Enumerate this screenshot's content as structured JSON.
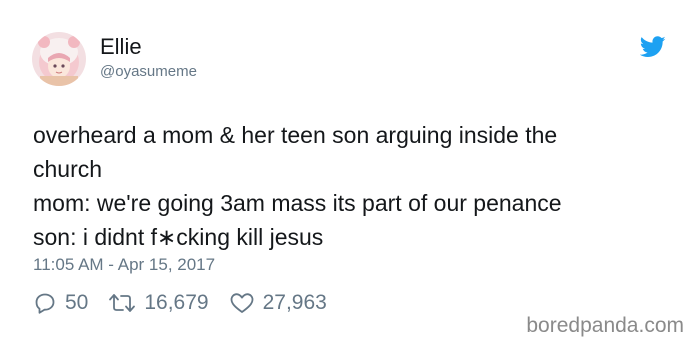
{
  "user": {
    "display_name": "Ellie",
    "handle": "@oyasumeme",
    "avatar_icon": "anime-avatar-icon"
  },
  "brand_icon": "twitter-bird-icon",
  "brand_color": "#1da1f2",
  "tweet": {
    "lines": [
      "overheard a mom & her teen son arguing inside the",
      "church",
      "mom: we're going 3am mass its part of our penance",
      "son: i didnt f∗cking kill jesus"
    ],
    "timestamp": "11:05 AM - Apr 15, 2017"
  },
  "actions": {
    "replies": "50",
    "retweets": "16,679",
    "likes": "27,963"
  },
  "watermark": "boredpanda.com"
}
